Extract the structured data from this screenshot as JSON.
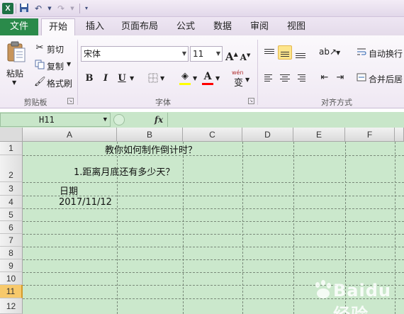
{
  "titlebar": {
    "app_icon": "excel-x-icon",
    "quick_access": [
      "save-icon",
      "undo-icon",
      "redo-icon",
      "customize-dropdown-icon"
    ]
  },
  "tabs": [
    {
      "label": "文件"
    },
    {
      "label": "开始"
    },
    {
      "label": "插入"
    },
    {
      "label": "页面布局"
    },
    {
      "label": "公式"
    },
    {
      "label": "数据"
    },
    {
      "label": "审阅"
    },
    {
      "label": "视图"
    }
  ],
  "ribbon": {
    "clipboard": {
      "paste": "粘贴",
      "cut": "剪切",
      "copy": "复制",
      "format_painter": "格式刷",
      "group": "剪贴板"
    },
    "font": {
      "font_name": "宋体",
      "font_size": "11",
      "bold": "B",
      "italic": "I",
      "underline": "U",
      "grow": "A",
      "shrink": "A",
      "phonetic": "wén",
      "phonetic_char": "变",
      "group": "字体",
      "fill_color": "#ffff00",
      "font_color": "#ff0000"
    },
    "alignment": {
      "wrap_text": "自动换行",
      "merge_center": "合并后居",
      "group": "对齐方式"
    }
  },
  "formula_bar": {
    "name_box": "H11",
    "fx": "fx",
    "formula": ""
  },
  "sheet": {
    "columns": [
      "A",
      "B",
      "C",
      "D",
      "E",
      "F"
    ],
    "rows": [
      "1",
      "2",
      "3",
      "4",
      "5",
      "6",
      "7",
      "8",
      "9",
      "10",
      "11",
      "12"
    ],
    "selected_row": "11",
    "cells": {
      "B1": "教你如何制作倒计时？",
      "A2": "1.距离月底还有多少天？",
      "A3": "日期",
      "A4": "2017/11/12"
    },
    "background": "#cbe8cc"
  },
  "watermark": {
    "text": "Baidu经验"
  }
}
